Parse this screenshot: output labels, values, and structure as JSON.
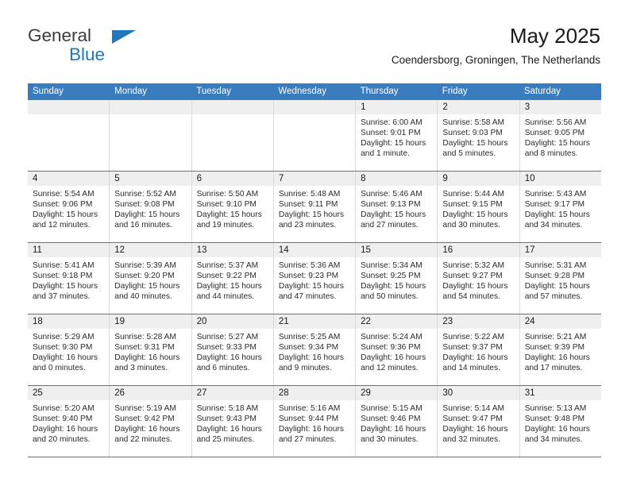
{
  "brand": {
    "name_part1": "General",
    "name_part2": "Blue",
    "accent_color": "#2077c0",
    "triangle_icon": "triangle-icon"
  },
  "header": {
    "title": "May 2025",
    "subtitle": "Coendersborg, Groningen, The Netherlands"
  },
  "calendar": {
    "header_bg": "#3a7dbf",
    "weekdays": [
      "Sunday",
      "Monday",
      "Tuesday",
      "Wednesday",
      "Thursday",
      "Friday",
      "Saturday"
    ],
    "weeks": [
      [
        {
          "day": "",
          "empty": true
        },
        {
          "day": "",
          "empty": true
        },
        {
          "day": "",
          "empty": true
        },
        {
          "day": "",
          "empty": true
        },
        {
          "day": "1",
          "sunrise": "Sunrise: 6:00 AM",
          "sunset": "Sunset: 9:01 PM",
          "daylight": "Daylight: 15 hours and 1 minute."
        },
        {
          "day": "2",
          "sunrise": "Sunrise: 5:58 AM",
          "sunset": "Sunset: 9:03 PM",
          "daylight": "Daylight: 15 hours and 5 minutes."
        },
        {
          "day": "3",
          "sunrise": "Sunrise: 5:56 AM",
          "sunset": "Sunset: 9:05 PM",
          "daylight": "Daylight: 15 hours and 8 minutes."
        }
      ],
      [
        {
          "day": "4",
          "sunrise": "Sunrise: 5:54 AM",
          "sunset": "Sunset: 9:06 PM",
          "daylight": "Daylight: 15 hours and 12 minutes."
        },
        {
          "day": "5",
          "sunrise": "Sunrise: 5:52 AM",
          "sunset": "Sunset: 9:08 PM",
          "daylight": "Daylight: 15 hours and 16 minutes."
        },
        {
          "day": "6",
          "sunrise": "Sunrise: 5:50 AM",
          "sunset": "Sunset: 9:10 PM",
          "daylight": "Daylight: 15 hours and 19 minutes."
        },
        {
          "day": "7",
          "sunrise": "Sunrise: 5:48 AM",
          "sunset": "Sunset: 9:11 PM",
          "daylight": "Daylight: 15 hours and 23 minutes."
        },
        {
          "day": "8",
          "sunrise": "Sunrise: 5:46 AM",
          "sunset": "Sunset: 9:13 PM",
          "daylight": "Daylight: 15 hours and 27 minutes."
        },
        {
          "day": "9",
          "sunrise": "Sunrise: 5:44 AM",
          "sunset": "Sunset: 9:15 PM",
          "daylight": "Daylight: 15 hours and 30 minutes."
        },
        {
          "day": "10",
          "sunrise": "Sunrise: 5:43 AM",
          "sunset": "Sunset: 9:17 PM",
          "daylight": "Daylight: 15 hours and 34 minutes."
        }
      ],
      [
        {
          "day": "11",
          "sunrise": "Sunrise: 5:41 AM",
          "sunset": "Sunset: 9:18 PM",
          "daylight": "Daylight: 15 hours and 37 minutes."
        },
        {
          "day": "12",
          "sunrise": "Sunrise: 5:39 AM",
          "sunset": "Sunset: 9:20 PM",
          "daylight": "Daylight: 15 hours and 40 minutes."
        },
        {
          "day": "13",
          "sunrise": "Sunrise: 5:37 AM",
          "sunset": "Sunset: 9:22 PM",
          "daylight": "Daylight: 15 hours and 44 minutes."
        },
        {
          "day": "14",
          "sunrise": "Sunrise: 5:36 AM",
          "sunset": "Sunset: 9:23 PM",
          "daylight": "Daylight: 15 hours and 47 minutes."
        },
        {
          "day": "15",
          "sunrise": "Sunrise: 5:34 AM",
          "sunset": "Sunset: 9:25 PM",
          "daylight": "Daylight: 15 hours and 50 minutes."
        },
        {
          "day": "16",
          "sunrise": "Sunrise: 5:32 AM",
          "sunset": "Sunset: 9:27 PM",
          "daylight": "Daylight: 15 hours and 54 minutes."
        },
        {
          "day": "17",
          "sunrise": "Sunrise: 5:31 AM",
          "sunset": "Sunset: 9:28 PM",
          "daylight": "Daylight: 15 hours and 57 minutes."
        }
      ],
      [
        {
          "day": "18",
          "sunrise": "Sunrise: 5:29 AM",
          "sunset": "Sunset: 9:30 PM",
          "daylight": "Daylight: 16 hours and 0 minutes."
        },
        {
          "day": "19",
          "sunrise": "Sunrise: 5:28 AM",
          "sunset": "Sunset: 9:31 PM",
          "daylight": "Daylight: 16 hours and 3 minutes."
        },
        {
          "day": "20",
          "sunrise": "Sunrise: 5:27 AM",
          "sunset": "Sunset: 9:33 PM",
          "daylight": "Daylight: 16 hours and 6 minutes."
        },
        {
          "day": "21",
          "sunrise": "Sunrise: 5:25 AM",
          "sunset": "Sunset: 9:34 PM",
          "daylight": "Daylight: 16 hours and 9 minutes."
        },
        {
          "day": "22",
          "sunrise": "Sunrise: 5:24 AM",
          "sunset": "Sunset: 9:36 PM",
          "daylight": "Daylight: 16 hours and 12 minutes."
        },
        {
          "day": "23",
          "sunrise": "Sunrise: 5:22 AM",
          "sunset": "Sunset: 9:37 PM",
          "daylight": "Daylight: 16 hours and 14 minutes."
        },
        {
          "day": "24",
          "sunrise": "Sunrise: 5:21 AM",
          "sunset": "Sunset: 9:39 PM",
          "daylight": "Daylight: 16 hours and 17 minutes."
        }
      ],
      [
        {
          "day": "25",
          "sunrise": "Sunrise: 5:20 AM",
          "sunset": "Sunset: 9:40 PM",
          "daylight": "Daylight: 16 hours and 20 minutes."
        },
        {
          "day": "26",
          "sunrise": "Sunrise: 5:19 AM",
          "sunset": "Sunset: 9:42 PM",
          "daylight": "Daylight: 16 hours and 22 minutes."
        },
        {
          "day": "27",
          "sunrise": "Sunrise: 5:18 AM",
          "sunset": "Sunset: 9:43 PM",
          "daylight": "Daylight: 16 hours and 25 minutes."
        },
        {
          "day": "28",
          "sunrise": "Sunrise: 5:16 AM",
          "sunset": "Sunset: 9:44 PM",
          "daylight": "Daylight: 16 hours and 27 minutes."
        },
        {
          "day": "29",
          "sunrise": "Sunrise: 5:15 AM",
          "sunset": "Sunset: 9:46 PM",
          "daylight": "Daylight: 16 hours and 30 minutes."
        },
        {
          "day": "30",
          "sunrise": "Sunrise: 5:14 AM",
          "sunset": "Sunset: 9:47 PM",
          "daylight": "Daylight: 16 hours and 32 minutes."
        },
        {
          "day": "31",
          "sunrise": "Sunrise: 5:13 AM",
          "sunset": "Sunset: 9:48 PM",
          "daylight": "Daylight: 16 hours and 34 minutes."
        }
      ]
    ]
  }
}
